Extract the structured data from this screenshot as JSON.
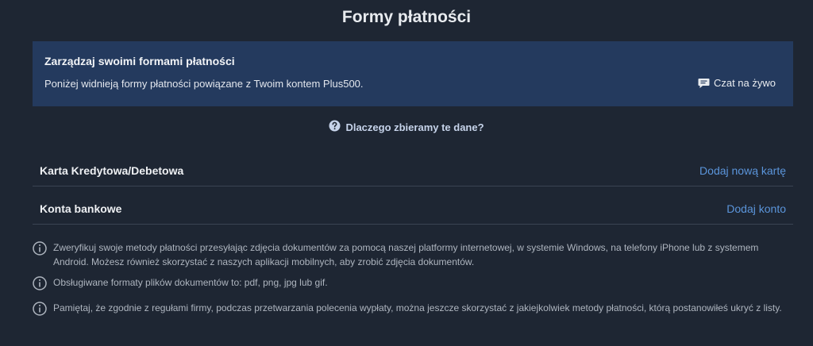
{
  "page": {
    "title": "Formy płatności"
  },
  "banner": {
    "heading": "Zarządzaj swoimi formami płatności",
    "text": "Poniżej widnieją formy płatności powiązane z Twoim kontem Plus500.",
    "chat_label": "Czat na żywo"
  },
  "why_link": "Dlaczego zbieramy te dane?",
  "methods": [
    {
      "label": "Karta Kredytowa/Debetowa",
      "action": "Dodaj nową kartę"
    },
    {
      "label": "Konta bankowe",
      "action": "Dodaj konto"
    }
  ],
  "notes": [
    "Zweryfikuj swoje metody płatności przesyłając zdjęcia dokumentów za pomocą naszej platformy internetowej, w systemie Windows, na telefony iPhone lub z systemem Android. Możesz również skorzystać z naszych aplikacji mobilnych, aby zrobić zdjęcia dokumentów.",
    "Obsługiwane formaty plików dokumentów to: pdf, png, jpg lub gif.",
    "Pamiętaj, że zgodnie z regułami firmy, podczas przetwarzania polecenia wypłaty, można jeszcze skorzystać z jakiejkolwiek metody płatności, którą postanowiłeś ukryć z listy."
  ],
  "colors": {
    "background": "#1e2633",
    "banner": "#243a5e",
    "link": "#5b95db"
  }
}
